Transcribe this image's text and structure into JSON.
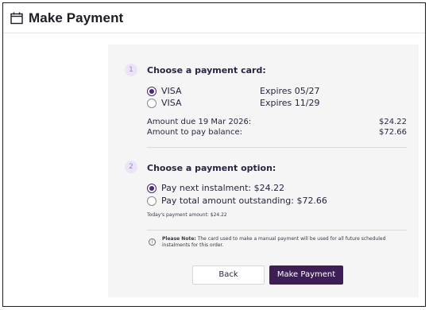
{
  "header": {
    "title": "Make Payment",
    "icon": "calendar-icon"
  },
  "step1": {
    "number": "1",
    "title": "Choose a payment card:",
    "cards": [
      {
        "brand": "VISA",
        "expiry": "Expires 05/27",
        "selected": true
      },
      {
        "brand": "VISA",
        "expiry": "Expires 11/29",
        "selected": false
      }
    ],
    "amount_due_label": "Amount due 19 Mar 2026:",
    "amount_due_value": "$24.22",
    "balance_label": "Amount to pay balance:",
    "balance_value": "$72.66"
  },
  "step2": {
    "number": "2",
    "title": "Choose a payment option:",
    "options": [
      {
        "label": "Pay next instalment: $24.22",
        "selected": true
      },
      {
        "label": "Pay total amount outstanding: $72.66",
        "selected": false
      }
    ],
    "today_label": "Today's payment amount: $24.22"
  },
  "note": {
    "bold": "Please Note:",
    "text": " The card used to make a manual payment will be used for all future scheduled instalments for this order."
  },
  "actions": {
    "back_label": "Back",
    "pay_label": "Make Payment"
  },
  "colors": {
    "accent": "#3d1f55",
    "step_bg": "#ebe4f7",
    "panel_bg": "#f5f5f6"
  }
}
